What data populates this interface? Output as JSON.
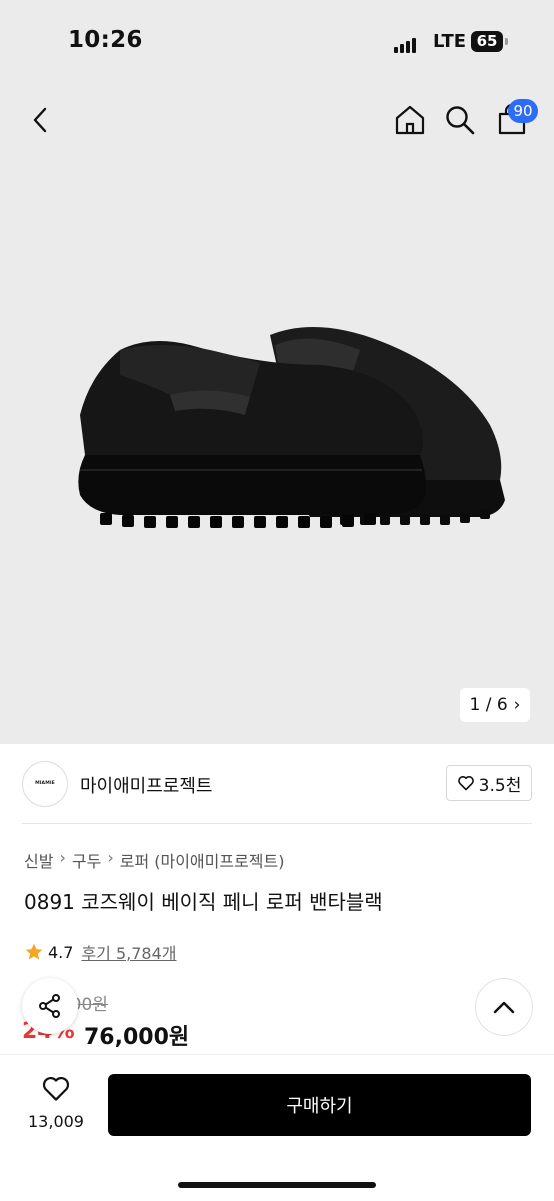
{
  "status": {
    "time": "10:26",
    "network": "LTE",
    "battery": "65"
  },
  "nav": {
    "cart_badge": "90"
  },
  "gallery": {
    "pager_text": "1 / 6",
    "pager_next": "›"
  },
  "brand": {
    "logo_text": "MIAMIE PROJECT",
    "name": "마이애미프로젝트",
    "likes": "3.5천"
  },
  "breadcrumb": [
    {
      "label": "신발"
    },
    {
      "label": "구두"
    },
    {
      "label": "로퍼 (마이애미프로젝트)"
    }
  ],
  "breadcrumb_separator": "›",
  "product": {
    "title": "0891 코즈웨이 베이직 페니 로퍼 밴타블랙",
    "rating": "4.7",
    "review_label": "후기 5,784개",
    "original_price": "100,000원",
    "discount": "24%",
    "price": "76,000원"
  },
  "bottom": {
    "like_count": "13,009",
    "buy_label": "구매하기"
  },
  "colors": {
    "accent": "#2d6cf6",
    "discount": "#e53935",
    "star": "#f5a623",
    "button": "#000000"
  },
  "icons": [
    "back-arrow-icon",
    "home-icon",
    "search-icon",
    "shopping-bag-icon",
    "heart-icon",
    "star-icon",
    "share-icon",
    "chevron-up-icon"
  ]
}
